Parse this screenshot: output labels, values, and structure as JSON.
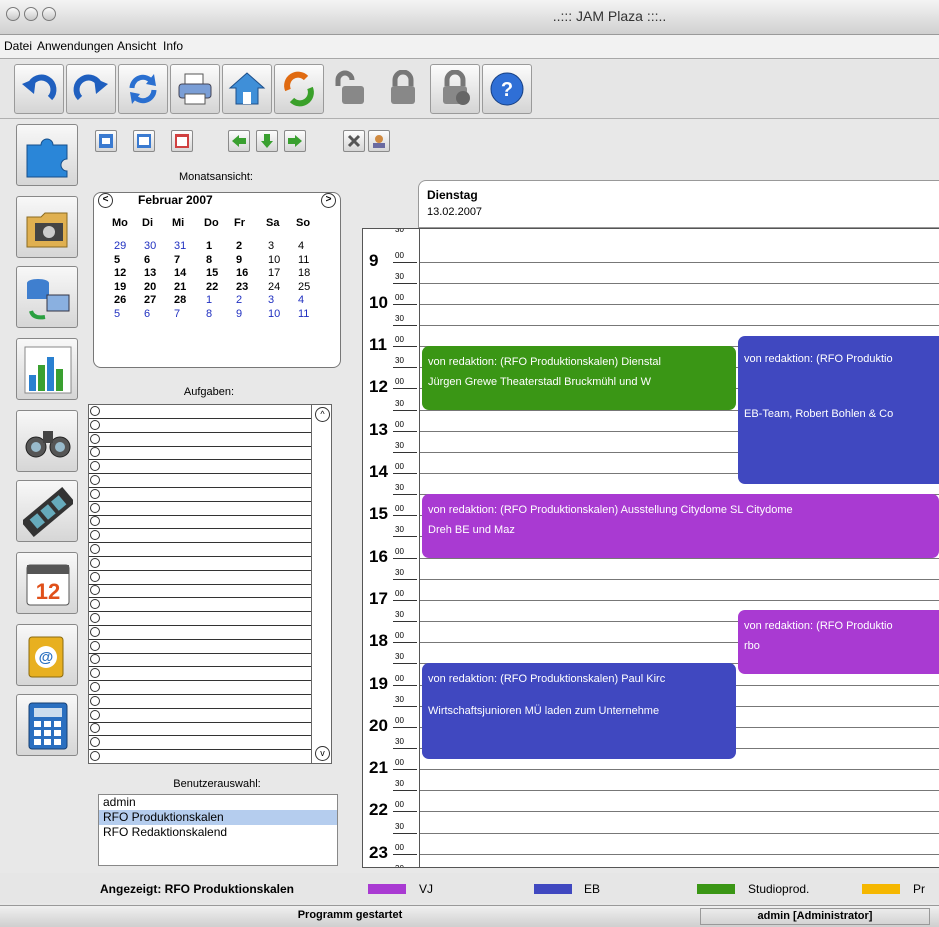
{
  "window": {
    "title": "..::: JAM Plaza :::.."
  },
  "menu": [
    "Datei",
    "Anwendungen",
    "Ansicht",
    "Info"
  ],
  "toolbar_icons": [
    "undo-icon",
    "redo-icon",
    "refresh-icon",
    "print-icon",
    "home-icon",
    "sync-icon",
    "unlock-icon",
    "lock-icon",
    "lock-check-icon",
    "help-icon"
  ],
  "sidebar_icons": [
    "puzzle-icon",
    "folder-film-icon",
    "database-sync-icon",
    "chart-icon",
    "binoculars-icon",
    "film-strip-icon",
    "calendar-icon",
    "address-book-icon",
    "calculator-icon"
  ],
  "month": {
    "section_label": "Monatsansicht:",
    "title": "Februar 2007",
    "prev": "<",
    "next": ">",
    "weekdays": [
      "Mo",
      "Di",
      "Mi",
      "Do",
      "Fr",
      "Sa",
      "So"
    ],
    "weeks": [
      [
        "29",
        "30",
        "31",
        "1",
        "2",
        "3",
        "4"
      ],
      [
        "5",
        "6",
        "7",
        "8",
        "9",
        "10",
        "11"
      ],
      [
        "12",
        "13",
        "14",
        "15",
        "16",
        "17",
        "18"
      ],
      [
        "19",
        "20",
        "21",
        "22",
        "23",
        "24",
        "25"
      ],
      [
        "26",
        "27",
        "28",
        "1",
        "2",
        "3",
        "4"
      ],
      [
        "5",
        "6",
        "7",
        "8",
        "9",
        "10",
        "11"
      ]
    ]
  },
  "tasks": {
    "label": "Aufgaben:"
  },
  "users": {
    "label": "Benutzerauswahl:",
    "items": [
      "admin",
      "RFO Produktionskalen",
      "RFO Redaktionskalend"
    ],
    "selected": "RFO Produktionskalen"
  },
  "day": {
    "name": "Dienstag",
    "date": "13.02.2007"
  },
  "hours": [
    "9",
    "10",
    "11",
    "12",
    "13",
    "14",
    "15",
    "16",
    "17",
    "18",
    "19",
    "20",
    "21",
    "22",
    "23"
  ],
  "minutes": {
    "zero": "00",
    "half": "30"
  },
  "events": [
    {
      "line1": "von redaktion: (RFO Produktionskalen) Dienstal",
      "line2": "Jürgen Grewe Theaterstadl Bruckmühl  und  W",
      "category": "Studioprod.",
      "start": "11:00",
      "end": "12:30"
    },
    {
      "line1": "von redaktion: (RFO Produktio",
      "line2": "EB-Team, Robert Bohlen & Co",
      "category": "EB",
      "start": "10:45",
      "end": "14:15"
    },
    {
      "line1": "von redaktion: (RFO Produktionskalen) Ausstellung Citydome SL    Citydome",
      "line2": "Dreh BE und Maz",
      "category": "VJ",
      "start": "14:30",
      "end": "16:00"
    },
    {
      "line1": "von redaktion: (RFO Produktio",
      "line2": "rbo",
      "category": "VJ",
      "start": "17:15",
      "end": "18:45"
    },
    {
      "line1": "von redaktion: (RFO Produktionskalen) Paul Kirc",
      "line2": "Wirtschaftsjunioren MÜ  laden zum Unternehme",
      "category": "EB",
      "start": "18:30",
      "end": "20:45"
    }
  ],
  "legend": {
    "shown_label": "Angezeigt: RFO Produktionskalen",
    "items": [
      {
        "name": "VJ",
        "color": "#a93ad2"
      },
      {
        "name": "EB",
        "color": "#4048c0"
      },
      {
        "name": "Studioprod.",
        "color": "#3a9615"
      },
      {
        "name": "Pr",
        "color": "#f5b700"
      }
    ]
  },
  "status": {
    "left": "Programm gestartet",
    "right": "admin [Administrator]"
  }
}
